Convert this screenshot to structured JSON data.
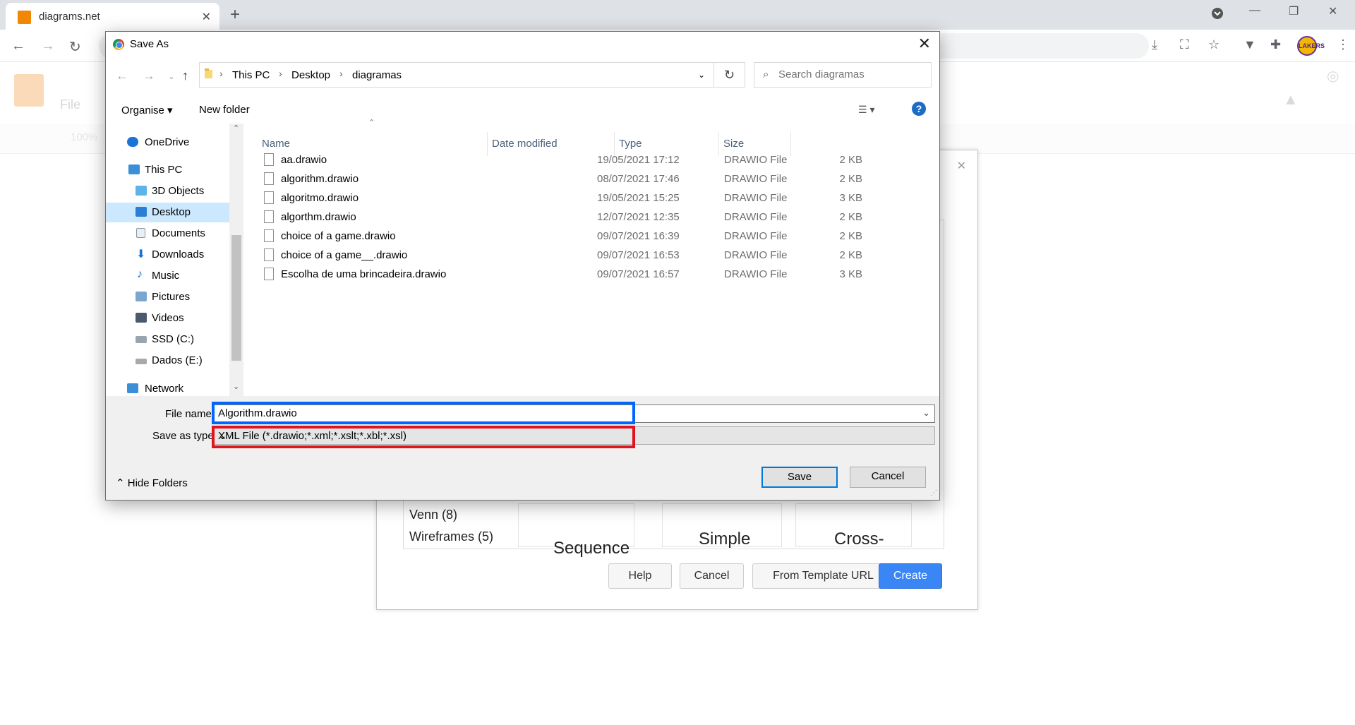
{
  "browser": {
    "tab_title": "diagrams.net",
    "newtab_symbol": "+",
    "tab_close_symbol": "✕",
    "profile_text": "LAKERS"
  },
  "app": {
    "menu_file": "File",
    "zoom": "100%"
  },
  "template_dialog": {
    "categories": [
      "Venn (8)",
      "Wireframes (5)"
    ],
    "thumb_labels": [
      "Sequence",
      "Simple",
      "Cross-"
    ],
    "buttons": {
      "help": "Help",
      "cancel": "Cancel",
      "from_url": "From Template URL",
      "create": "Create"
    },
    "accent": "#3a86f5"
  },
  "save_as": {
    "title": "Save As",
    "breadcrumb": [
      "This PC",
      "Desktop",
      "diagramas"
    ],
    "search_placeholder": "Search diagramas",
    "commands": {
      "organise": "Organise",
      "new_folder": "New folder"
    },
    "nav_items": [
      {
        "label": "OneDrive",
        "icon": "cloud-icon"
      },
      {
        "label": "This PC",
        "icon": "computer-icon"
      },
      {
        "label": "3D Objects",
        "icon": "cube-icon"
      },
      {
        "label": "Desktop",
        "icon": "desktop-icon",
        "selected": true
      },
      {
        "label": "Documents",
        "icon": "document-icon"
      },
      {
        "label": "Downloads",
        "icon": "download-icon"
      },
      {
        "label": "Music",
        "icon": "music-icon"
      },
      {
        "label": "Pictures",
        "icon": "pictures-icon"
      },
      {
        "label": "Videos",
        "icon": "video-icon"
      },
      {
        "label": "SSD (C:)",
        "icon": "drive-icon"
      },
      {
        "label": "Dados (E:)",
        "icon": "drive-icon"
      },
      {
        "label": "Network",
        "icon": "network-icon"
      }
    ],
    "columns": [
      "Name",
      "Date modified",
      "Type",
      "Size"
    ],
    "files": [
      {
        "name": "aa.drawio",
        "date": "19/05/2021 17:12",
        "type": "DRAWIO File",
        "size": "2 KB"
      },
      {
        "name": "algorithm.drawio",
        "date": "08/07/2021 17:46",
        "type": "DRAWIO File",
        "size": "2 KB"
      },
      {
        "name": "algoritmo.drawio",
        "date": "19/05/2021 15:25",
        "type": "DRAWIO File",
        "size": "3 KB"
      },
      {
        "name": "algorthm.drawio",
        "date": "12/07/2021 12:35",
        "type": "DRAWIO File",
        "size": "2 KB"
      },
      {
        "name": "choice of a game.drawio",
        "date": "09/07/2021 16:39",
        "type": "DRAWIO File",
        "size": "2 KB"
      },
      {
        "name": "choice of a game__.drawio",
        "date": "09/07/2021 16:53",
        "type": "DRAWIO File",
        "size": "2 KB"
      },
      {
        "name": "Escolha de uma brincadeira.drawio",
        "date": "09/07/2021 16:57",
        "type": "DRAWIO File",
        "size": "3 KB"
      }
    ],
    "file_name_label": "File name:",
    "file_name_value": "Algorithm.drawio",
    "save_type_label": "Save as type:",
    "save_type_value": "XML File (*.drawio;*.xml;*.xslt;*.xbl;*.xsl)",
    "hide_folders": "Hide Folders",
    "save": "Save",
    "cancel": "Cancel",
    "highlight_colors": {
      "file_name": "#0066ff",
      "save_type": "#e0141e"
    }
  }
}
